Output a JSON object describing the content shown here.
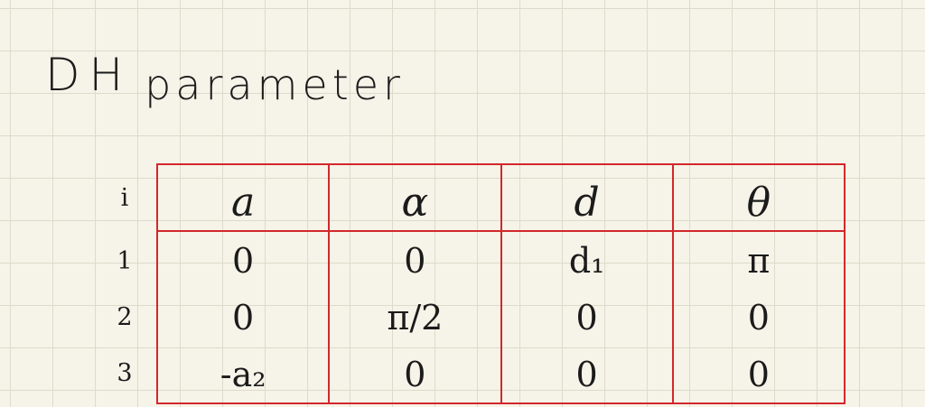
{
  "title": {
    "word1": "DH",
    "word2": "parameter"
  },
  "index_header": "i",
  "columns": [
    "a",
    "α",
    "d",
    "θ"
  ],
  "rows": [
    {
      "index": "1",
      "cells": [
        "0",
        "0",
        "d₁",
        "π"
      ]
    },
    {
      "index": "2",
      "cells": [
        "0",
        "π/2",
        "0",
        "0"
      ]
    },
    {
      "index": "3",
      "cells": [
        "-a₂",
        "0",
        "0",
        "0"
      ]
    }
  ],
  "colors": {
    "paper": "#f6f3e8",
    "grid_line": "#dcdccb",
    "table_line": "#d2282b",
    "ink": "#1b1b1b"
  }
}
